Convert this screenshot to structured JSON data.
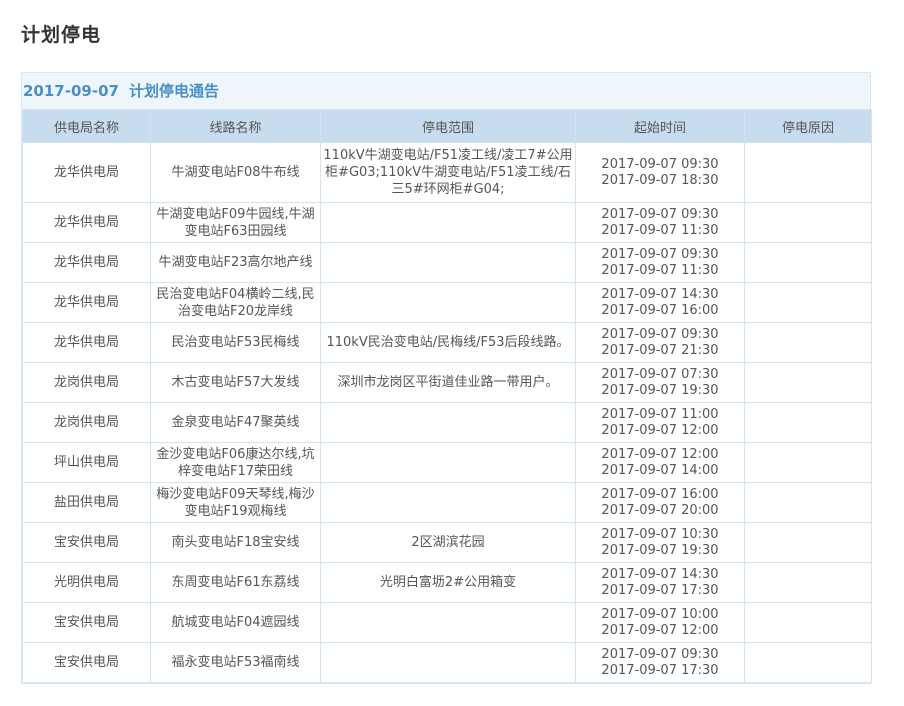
{
  "page": {
    "title": "计划停电"
  },
  "notice": {
    "date": "2017-09-07",
    "title": "计划停电通告"
  },
  "table": {
    "headers": [
      "供电局名称",
      "线路名称",
      "停电范围",
      "起始时间",
      "停电原因"
    ],
    "rows": [
      {
        "bureau": "龙华供电局",
        "line": "牛湖变电站F08牛布线",
        "scope": "110kV牛湖变电站/F51凌工线/凌工7#公用柜#G03;110kV牛湖变电站/F51凌工线/石三5#环网柜#G04;",
        "start": "2017-09-07 09:30",
        "end": "2017-09-07 18:30",
        "reason": ""
      },
      {
        "bureau": "龙华供电局",
        "line": "牛湖变电站F09牛园线,牛湖变电站F63田园线",
        "scope": "",
        "start": "2017-09-07 09:30",
        "end": "2017-09-07 11:30",
        "reason": ""
      },
      {
        "bureau": "龙华供电局",
        "line": "牛湖变电站F23高尔地产线",
        "scope": "",
        "start": "2017-09-07 09:30",
        "end": "2017-09-07 11:30",
        "reason": ""
      },
      {
        "bureau": "龙华供电局",
        "line": "民治变电站F04横岭二线,民治变电站F20龙岸线",
        "scope": "",
        "start": "2017-09-07 14:30",
        "end": "2017-09-07 16:00",
        "reason": ""
      },
      {
        "bureau": "龙华供电局",
        "line": "民治变电站F53民梅线",
        "scope": "110kV民治变电站/民梅线/F53后段线路。",
        "start": "2017-09-07 09:30",
        "end": "2017-09-07 21:30",
        "reason": ""
      },
      {
        "bureau": "龙岗供电局",
        "line": "木古变电站F57大发线",
        "scope": "深圳市龙岗区平街道佳业路一带用户。",
        "start": "2017-09-07 07:30",
        "end": "2017-09-07 19:30",
        "reason": ""
      },
      {
        "bureau": "龙岗供电局",
        "line": "金泉变电站F47聚英线",
        "scope": "",
        "start": "2017-09-07 11:00",
        "end": "2017-09-07 12:00",
        "reason": ""
      },
      {
        "bureau": "坪山供电局",
        "line": "金沙变电站F06康达尔线,坑梓变电站F17荣田线",
        "scope": "",
        "start": "2017-09-07 12:00",
        "end": "2017-09-07 14:00",
        "reason": ""
      },
      {
        "bureau": "盐田供电局",
        "line": "梅沙变电站F09天琴线,梅沙变电站F19观梅线",
        "scope": "",
        "start": "2017-09-07 16:00",
        "end": "2017-09-07 20:00",
        "reason": ""
      },
      {
        "bureau": "宝安供电局",
        "line": "南头变电站F18宝安线",
        "scope": "2区湖滨花园",
        "start": "2017-09-07 10:30",
        "end": "2017-09-07 19:30",
        "reason": ""
      },
      {
        "bureau": "光明供电局",
        "line": "东周变电站F61东荔线",
        "scope": "光明白富坜2#公用箱变",
        "start": "2017-09-07 14:30",
        "end": "2017-09-07 17:30",
        "reason": ""
      },
      {
        "bureau": "宝安供电局",
        "line": "航城变电站F04遮园线",
        "scope": "",
        "start": "2017-09-07 10:00",
        "end": "2017-09-07 12:00",
        "reason": ""
      },
      {
        "bureau": "宝安供电局",
        "line": "福永变电站F53福南线",
        "scope": "",
        "start": "2017-09-07 09:30",
        "end": "2017-09-07 17:30",
        "reason": ""
      }
    ]
  }
}
